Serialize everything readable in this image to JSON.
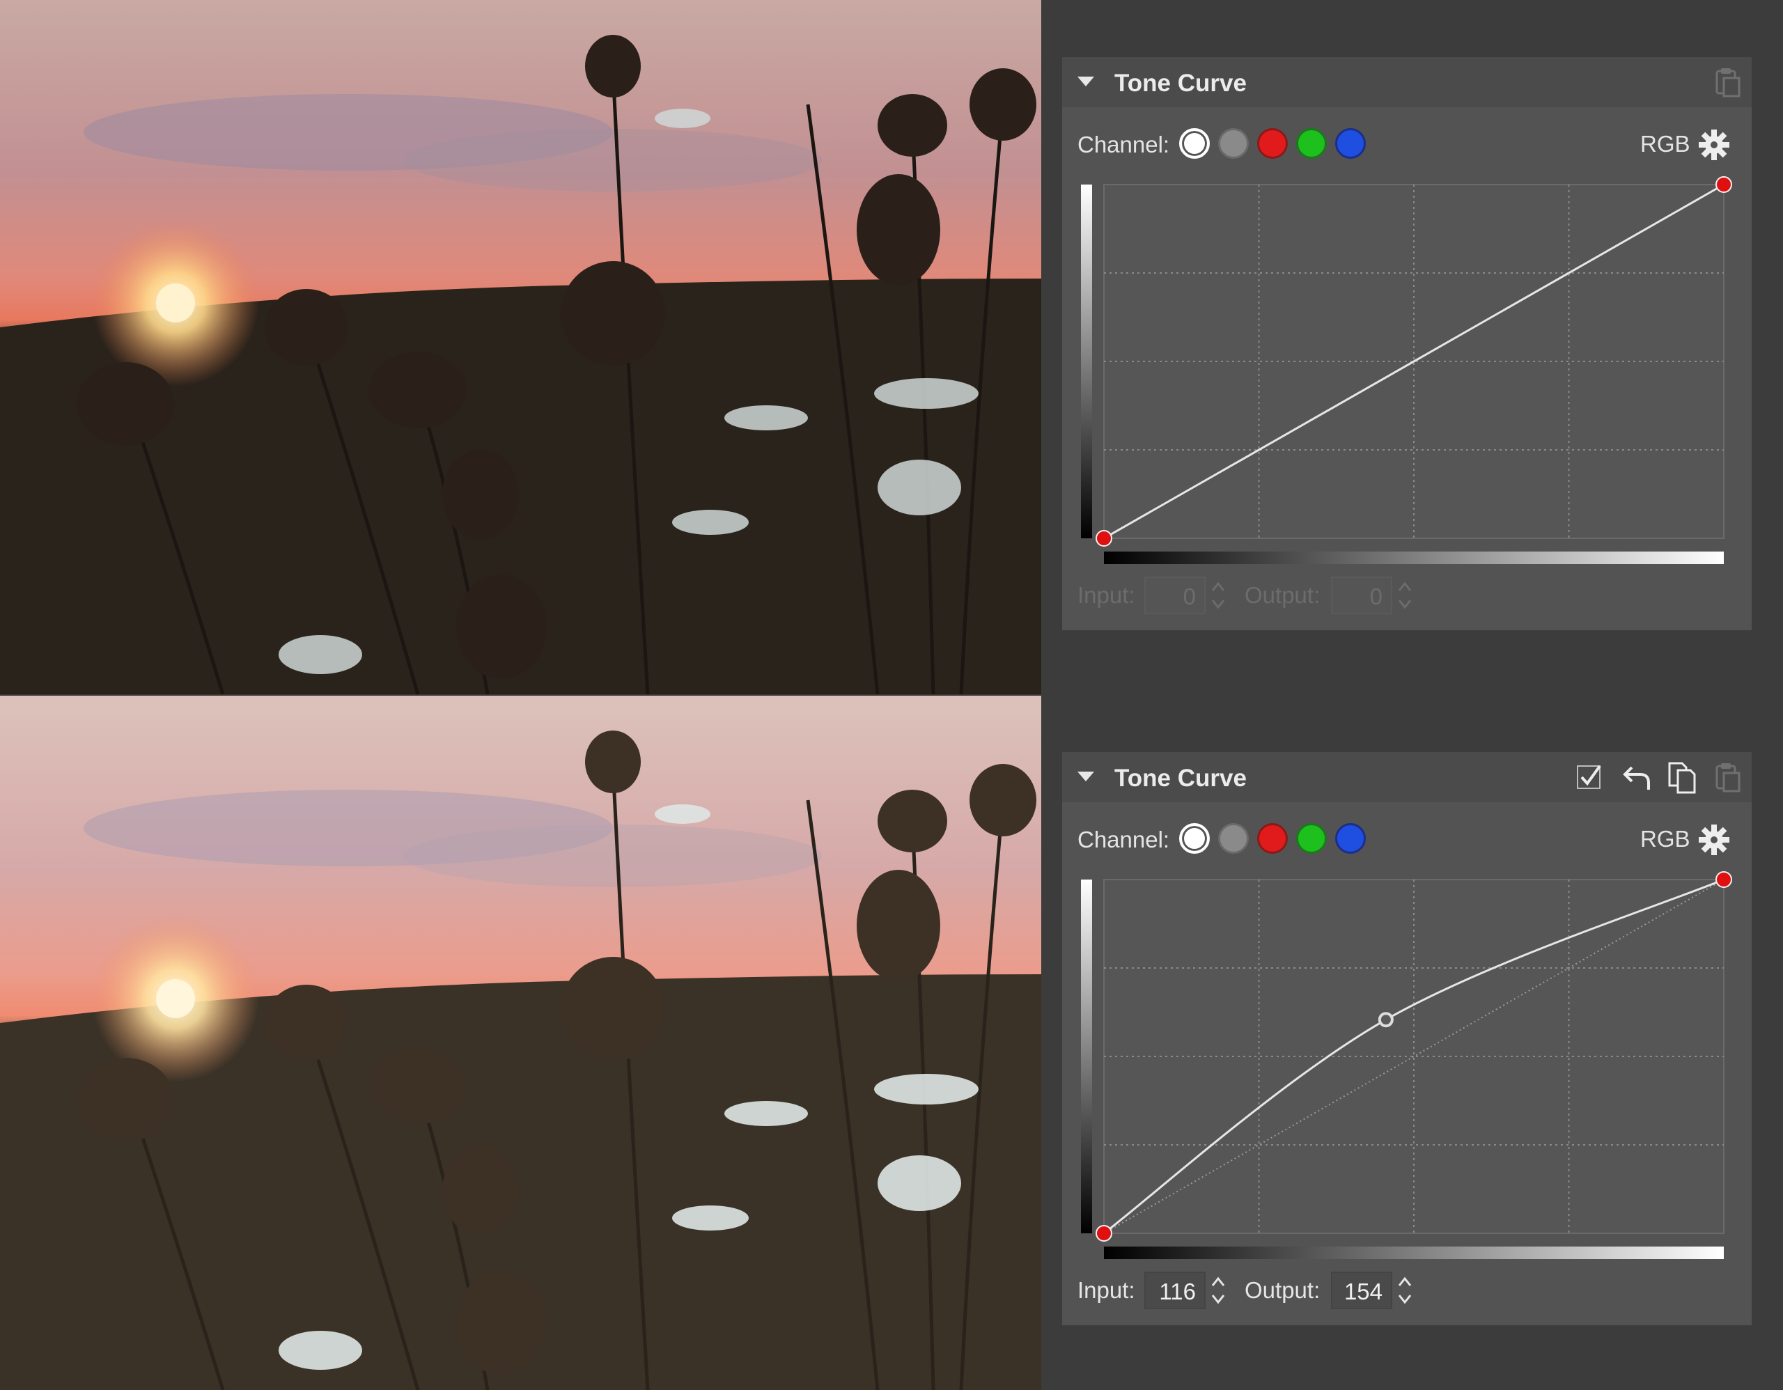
{
  "panels": {
    "before": {
      "title": "Tone Curve",
      "channel_label": "Channel:",
      "channels": [
        "luminance",
        "gray",
        "red",
        "green",
        "blue"
      ],
      "selected_channel": "luminance",
      "mode_label": "RGB",
      "input_label": "Input:",
      "input_value": "0",
      "output_label": "Output:",
      "output_value": "0",
      "enabled": false,
      "header_icons": [
        "paste-icon"
      ]
    },
    "after": {
      "title": "Tone Curve",
      "channel_label": "Channel:",
      "channels": [
        "luminance",
        "gray",
        "red",
        "green",
        "blue"
      ],
      "selected_channel": "luminance",
      "mode_label": "RGB",
      "input_label": "Input:",
      "input_value": "116",
      "output_label": "Output:",
      "output_value": "154",
      "enabled": true,
      "header_icons": [
        "checkmark-icon",
        "undo-icon",
        "copy-icon",
        "paste-icon"
      ]
    }
  },
  "colors": {
    "panel_bg": "#535353",
    "header_bg": "#4b4b4b",
    "red_point": "#e01010",
    "channel_gray": "#8a8a8a",
    "channel_red": "#e11b1b",
    "channel_green": "#1ec01e",
    "channel_blue": "#1f4fe0"
  },
  "chart_data": [
    {
      "type": "line",
      "panel": "before",
      "xlim": [
        0,
        255
      ],
      "ylim": [
        0,
        255
      ],
      "grid": true,
      "series": [
        {
          "points": [
            [
              0,
              0
            ],
            [
              255,
              255
            ]
          ]
        }
      ],
      "control_points": [
        [
          0,
          0
        ],
        [
          255,
          255
        ]
      ]
    },
    {
      "type": "line",
      "panel": "after",
      "xlim": [
        0,
        255
      ],
      "ylim": [
        0,
        255
      ],
      "grid": true,
      "series": [
        {
          "points": [
            [
              0,
              0
            ],
            [
              116,
              154
            ],
            [
              255,
              255
            ]
          ]
        }
      ],
      "control_points": [
        [
          0,
          0
        ],
        [
          116,
          154
        ],
        [
          255,
          255
        ]
      ],
      "selected_point": [
        116,
        154
      ]
    }
  ]
}
